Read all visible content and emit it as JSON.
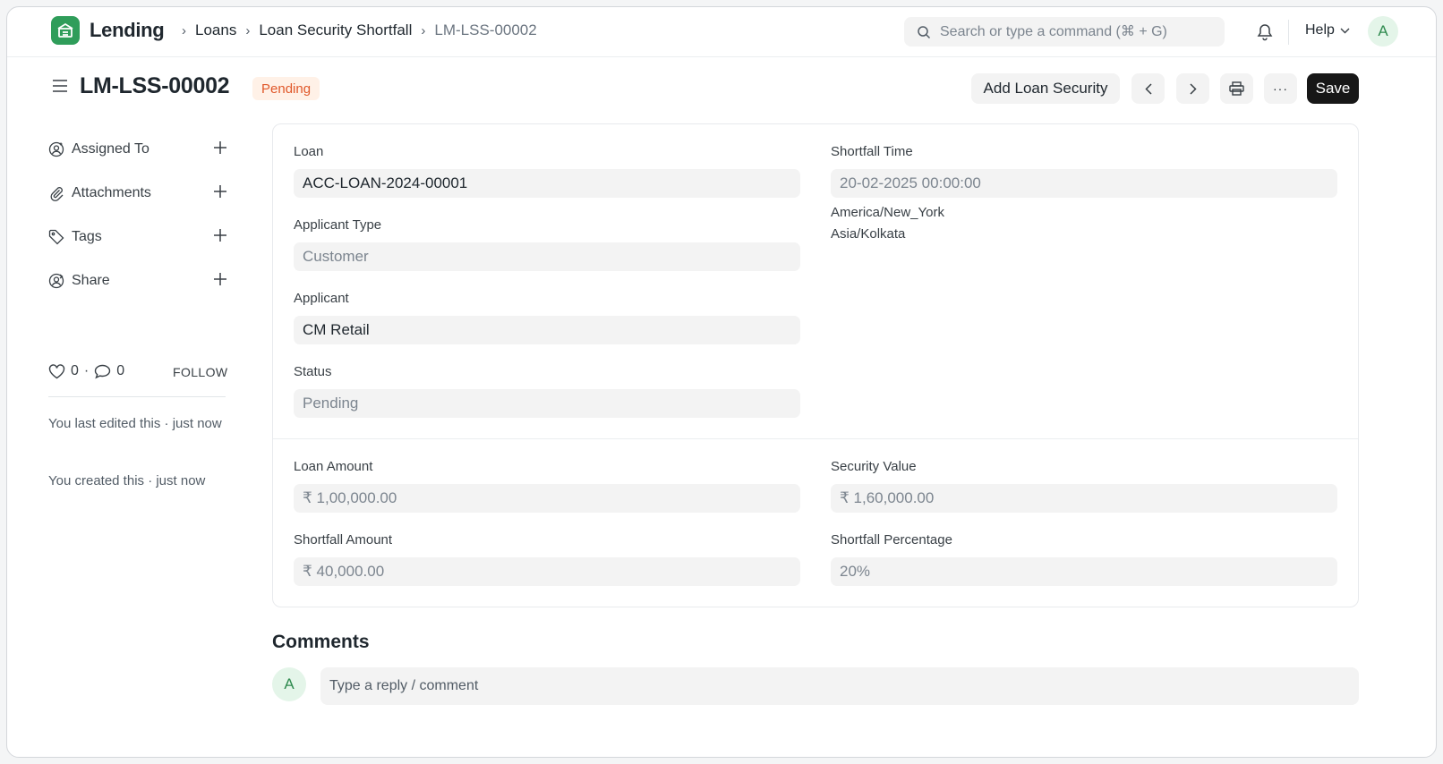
{
  "navbar": {
    "app_name": "Lending",
    "breadcrumbs": [
      "Loans",
      "Loan Security Shortfall",
      "LM-LSS-00002"
    ],
    "search_placeholder": "Search or type a command (⌘ + G)",
    "help_label": "Help",
    "user_initial": "A"
  },
  "header": {
    "title": "LM-LSS-00002",
    "status": "Pending",
    "add_security_label": "Add Loan Security",
    "more_label": "···",
    "save_label": "Save"
  },
  "sidebar": {
    "items": [
      {
        "label": "Assigned To",
        "icon": "user-plus-icon"
      },
      {
        "label": "Attachments",
        "icon": "paperclip-icon"
      },
      {
        "label": "Tags",
        "icon": "tag-icon"
      },
      {
        "label": "Share",
        "icon": "share-user-icon"
      }
    ],
    "likes": "0",
    "dot": "·",
    "comments": "0",
    "follow_label": "FOLLOW",
    "last_edited": "You last edited this · just now",
    "created": "You created this · just now"
  },
  "form": {
    "loan": {
      "label": "Loan",
      "value": "ACC-LOAN-2024-00001"
    },
    "applicant_type": {
      "label": "Applicant Type",
      "value": "Customer"
    },
    "applicant": {
      "label": "Applicant",
      "value": "CM Retail"
    },
    "status": {
      "label": "Status",
      "value": "Pending"
    },
    "shortfall_time": {
      "label": "Shortfall Time",
      "value": "20-02-2025 00:00:00",
      "timezones": [
        "America/New_York",
        "Asia/Kolkata"
      ]
    },
    "loan_amount": {
      "label": "Loan Amount",
      "value": "₹ 1,00,000.00"
    },
    "security_value": {
      "label": "Security Value",
      "value": "₹ 1,60,000.00"
    },
    "shortfall_amount": {
      "label": "Shortfall Amount",
      "value": "₹ 40,000.00"
    },
    "shortfall_percentage": {
      "label": "Shortfall Percentage",
      "value": "20%"
    }
  },
  "comments": {
    "title": "Comments",
    "user_initial": "A",
    "placeholder": "Type a reply / comment"
  },
  "colors": {
    "brand": "#2f9d5a",
    "status_pending": "#e0582a",
    "primary_button": "#171717"
  }
}
